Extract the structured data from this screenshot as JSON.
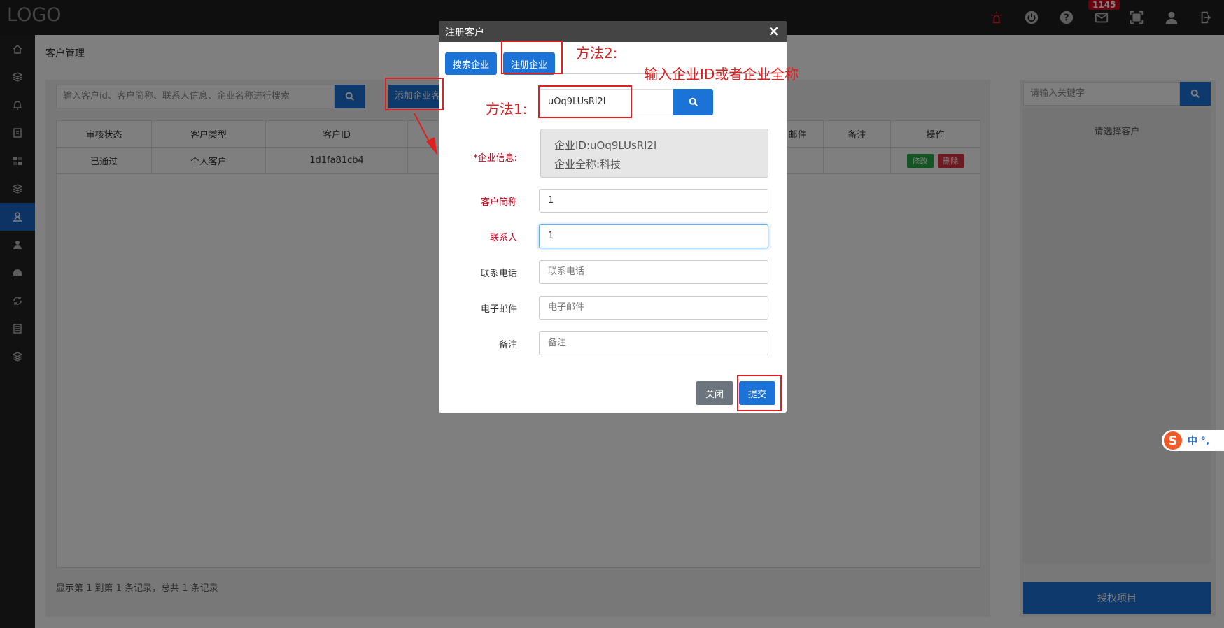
{
  "app": {
    "logo": "LOGO",
    "notification_count": "1145"
  },
  "top_icons": [
    "alarm-icon",
    "power-icon",
    "help-icon",
    "mail-icon",
    "fullscreen-icon",
    "user-icon",
    "logout-icon"
  ],
  "sidebar_icons": [
    "home-icon",
    "layers-icon",
    "bell-icon",
    "document-icon",
    "dashboard-icon",
    "layers-icon",
    "customer-icon",
    "team-icon",
    "gauge-icon",
    "sync-icon",
    "list-icon",
    "layers-icon"
  ],
  "page": {
    "title": "客户管理",
    "search_placeholder": "输入客户id、客户简称、联系人信息、企业名称进行搜索",
    "add_button": "添加企业客户",
    "footer": "显示第 1 到第 1 条记录，总共 1 条记录"
  },
  "table": {
    "headers": [
      "审核状态",
      "客户类型",
      "客户ID",
      "",
      "",
      "",
      "",
      "邮件",
      "备注",
      "操作"
    ],
    "rows": [
      {
        "status": "已通过",
        "type": "个人客户",
        "id": "1d1fa81cb4"
      }
    ],
    "edit_label": "修改",
    "delete_label": "删除"
  },
  "right_panel": {
    "keyword_placeholder": "请输入关键字",
    "select_prompt": "请选择客户",
    "authorize_button": "授权项目"
  },
  "ime": {
    "logo": "S",
    "text": "中 °,"
  },
  "modal": {
    "title": "注册客户",
    "close_icon": "×",
    "tab_search": "搜索企业",
    "tab_register": "注册企业",
    "enterprise_input": "uOq9LUsRl2l",
    "enterprise_info_label": "*企业信息:",
    "enterprise_id_line": "企业ID:uOq9LUsRl2l",
    "enterprise_name_line": "企业全称:科技",
    "fields": [
      {
        "label": "客户简称",
        "value": "1",
        "required": true
      },
      {
        "label": "联系人",
        "value": "1",
        "required": true
      },
      {
        "label": "联系电话",
        "placeholder": "联系电话"
      },
      {
        "label": "电子邮件",
        "placeholder": "电子邮件"
      },
      {
        "label": "备注",
        "placeholder": "备注"
      }
    ],
    "close_button": "关闭",
    "submit_button": "提交"
  },
  "annotations": {
    "method2": "方法2:",
    "hint": "输入企业ID或者企业全称",
    "method1": "方法1:"
  },
  "colors": {
    "primary": "#1b73d8",
    "annotation": "#e02020",
    "topbar": "#1f1f1f"
  }
}
